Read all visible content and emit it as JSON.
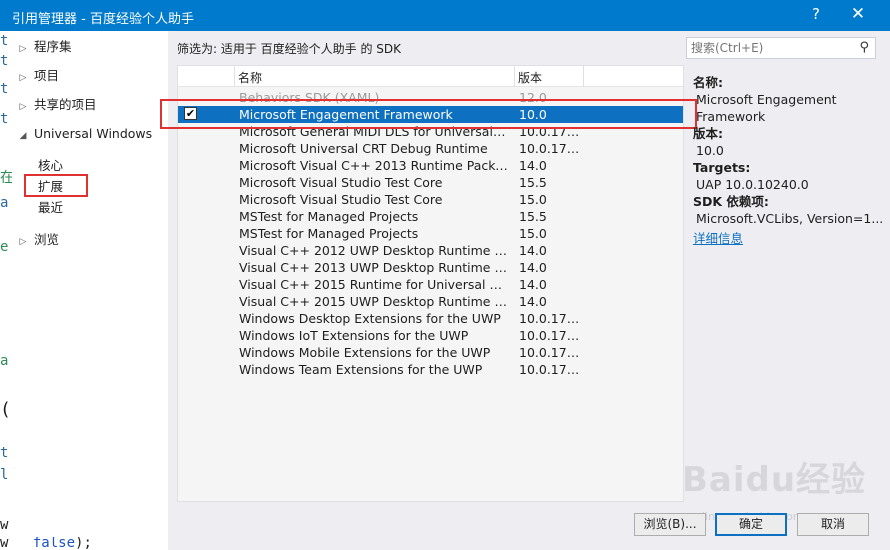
{
  "window": {
    "title": "引用管理器 - 百度经验个人助手",
    "help_label": "?",
    "close_label": "✕"
  },
  "gutter_chars": [
    "t",
    "t",
    "t",
    "t",
    "在",
    "a",
    "e",
    "a",
    "(",
    "t",
    "l",
    "w"
  ],
  "tree": {
    "items": [
      {
        "label": "程序集",
        "arrow": "▷"
      },
      {
        "label": "项目",
        "arrow": "▷"
      },
      {
        "label": "共享的项目",
        "arrow": "▷"
      },
      {
        "label": "Universal Windows",
        "arrow": "◢"
      }
    ],
    "sub_items": [
      {
        "label": "核心"
      },
      {
        "label": "扩展"
      },
      {
        "label": "最近"
      }
    ],
    "browse": {
      "label": "浏览",
      "arrow": "▷"
    }
  },
  "filter_label": "筛选为: 适用于 百度经验个人助手 的 SDK",
  "search": {
    "placeholder": "搜索(Ctrl+E)",
    "icon": "search-icon"
  },
  "list": {
    "columns": {
      "name": "名称",
      "version": "版本"
    },
    "rows": [
      {
        "name": "Behaviors SDK (XAML)",
        "version": "12.0",
        "state": "faded"
      },
      {
        "name": "Microsoft Engagement Framework",
        "version": "10.0",
        "state": "selected",
        "checked": "✔"
      },
      {
        "name": "Microsoft General MIDI DLS for Universal W...",
        "version": "10.0.171...",
        "state": ""
      },
      {
        "name": "Microsoft Universal CRT Debug Runtime",
        "version": "10.0.171...",
        "state": ""
      },
      {
        "name": "Microsoft Visual C++ 2013 Runtime Packag...",
        "version": "14.0",
        "state": ""
      },
      {
        "name": "Microsoft Visual Studio Test Core",
        "version": "15.5",
        "state": ""
      },
      {
        "name": "Microsoft Visual Studio Test Core",
        "version": "15.0",
        "state": ""
      },
      {
        "name": "MSTest for Managed Projects",
        "version": "15.5",
        "state": ""
      },
      {
        "name": "MSTest for Managed Projects",
        "version": "15.0",
        "state": ""
      },
      {
        "name": "Visual C++ 2012 UWP Desktop Runtime for...",
        "version": "14.0",
        "state": ""
      },
      {
        "name": "Visual C++ 2013 UWP Desktop Runtime for...",
        "version": "14.0",
        "state": ""
      },
      {
        "name": "Visual C++ 2015 Runtime for Universal Win...",
        "version": "14.0",
        "state": ""
      },
      {
        "name": "Visual C++ 2015 UWP Desktop Runtime for...",
        "version": "14.0",
        "state": ""
      },
      {
        "name": "Windows Desktop Extensions for the UWP",
        "version": "10.0.171...",
        "state": ""
      },
      {
        "name": "Windows IoT Extensions for the UWP",
        "version": "10.0.171...",
        "state": ""
      },
      {
        "name": "Windows Mobile Extensions for the UWP",
        "version": "10.0.171...",
        "state": ""
      },
      {
        "name": "Windows Team Extensions for the UWP",
        "version": "10.0.171...",
        "state": ""
      }
    ]
  },
  "details": {
    "name_label": "名称:",
    "name_value_1": "Microsoft Engagement",
    "name_value_2": "Framework",
    "version_label": "版本:",
    "version_value": "10.0",
    "targets_label": "Targets:",
    "targets_value": "UAP 10.0.10240.0",
    "deps_label": "SDK 依赖项:",
    "deps_value": "Microsoft.VCLibs, Version=1...",
    "more_link": "详细信息"
  },
  "buttons": {
    "browse": "浏览(B)...",
    "ok": "确定",
    "cancel": "取消"
  },
  "watermark": {
    "big": "Baidu经验",
    "small": "jingyan.baidu.com"
  },
  "editor_line": {
    "text": "w",
    "keyword": "false",
    "tail": ");"
  },
  "colors": {
    "accent": "#007acc",
    "selection": "#0e70c0",
    "highlight_box": "#e03030"
  }
}
